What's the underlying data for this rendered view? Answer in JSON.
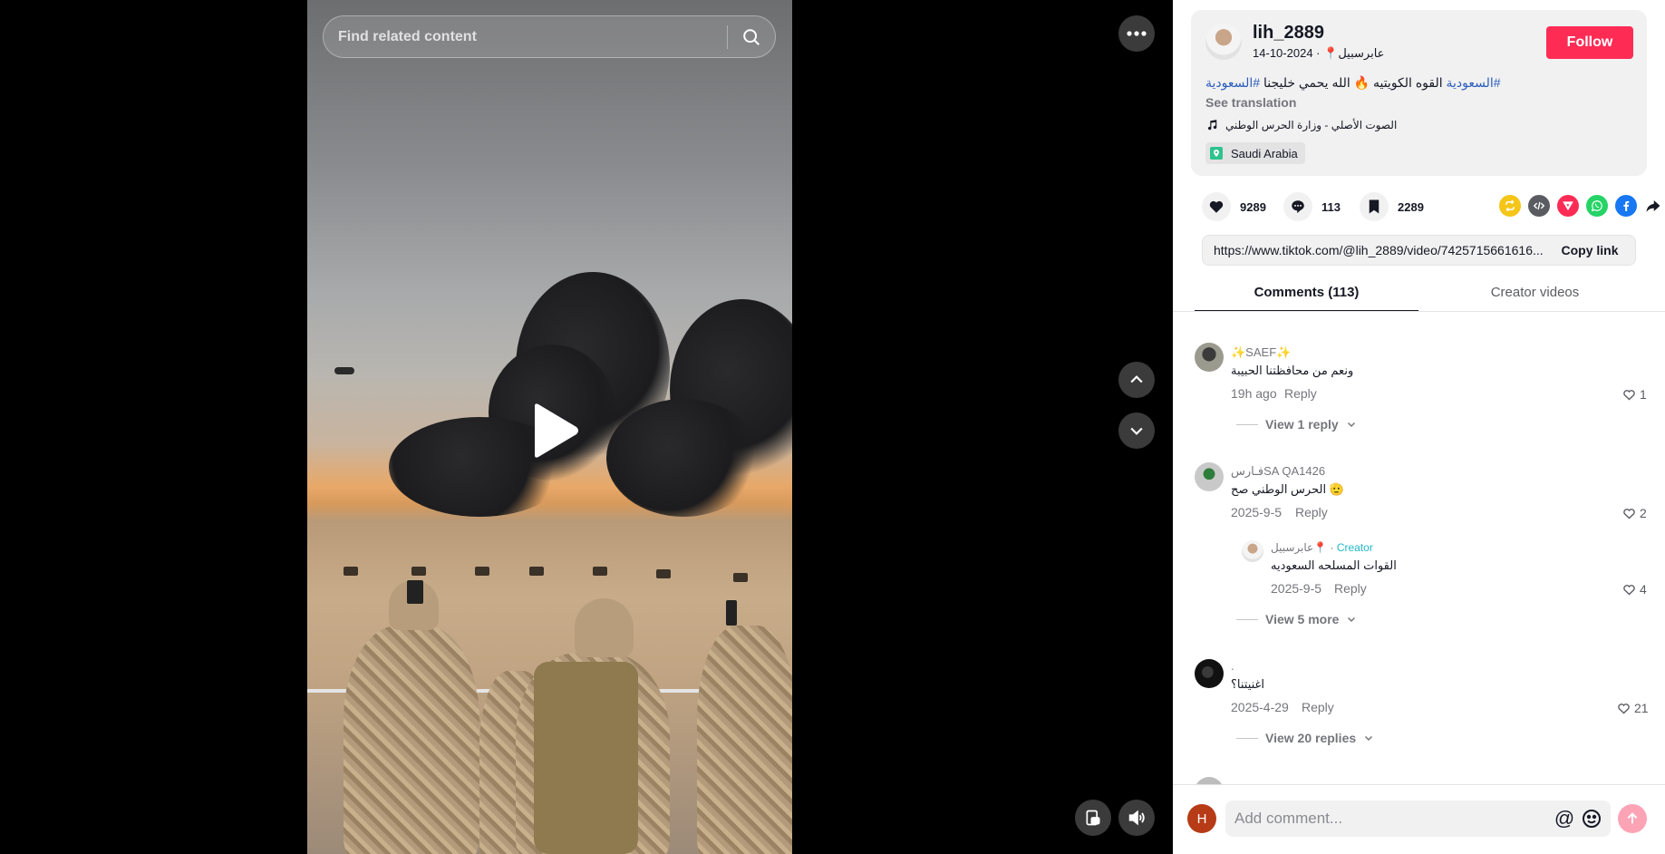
{
  "search": {
    "placeholder": "Find related content"
  },
  "video": {
    "state": "paused"
  },
  "author": {
    "username": "lih_2889",
    "nickname": "عابرسبيل📍",
    "separator": "·",
    "date": "2024-10-14",
    "follow_label": "Follow"
  },
  "post": {
    "caption_tag_1": "#السعودية",
    "caption_text": " القوه الكويتيه 🔥 الله يحمي خليجنا ",
    "caption_tag_2": "#السعودية",
    "see_translation": "See translation",
    "music": "الصوت الأصلي - وزارة الحرس الوطني",
    "location": "Saudi Arabia"
  },
  "stats": {
    "likes": "9289",
    "comments": "113",
    "saves": "2289"
  },
  "share": {
    "link": "https://www.tiktok.com/@lih_2889/video/7425715661616...",
    "copy_label": "Copy link",
    "colors": {
      "repost": "#f5c518",
      "embed": "#5b5c62",
      "send": "#fe2c55",
      "whatsapp": "#25d366",
      "facebook": "#1877f2"
    }
  },
  "tabs": {
    "comments": "Comments (113)",
    "creator_videos": "Creator videos"
  },
  "comments": [
    {
      "name": "✨SAEF✨",
      "text": "ونعم من محافظتنا الحبيبة",
      "time": "19h ago",
      "reply": "Reply",
      "likes": "1",
      "view": "View 1 reply"
    },
    {
      "name": "فـارسSA QA1426",
      "text": "الحرس الوطني صح 🫡",
      "time": "2025-9-5",
      "reply": "Reply",
      "likes": "2",
      "sub": {
        "name": "عابرسبيل📍",
        "separator": "·",
        "creator": "Creator",
        "text": "القوات المسلحه السعوديه",
        "time": "2025-9-5",
        "reply": "Reply",
        "likes": "4"
      },
      "view": "View 5 more"
    },
    {
      "name": ".",
      "text": "اغنيتنا؟",
      "time": "2025-4-29",
      "reply": "Reply",
      "likes": "21",
      "view": "View 20 replies"
    }
  ],
  "composer": {
    "placeholder": "Add comment...",
    "avatar_letter": "H",
    "mention": "@"
  }
}
